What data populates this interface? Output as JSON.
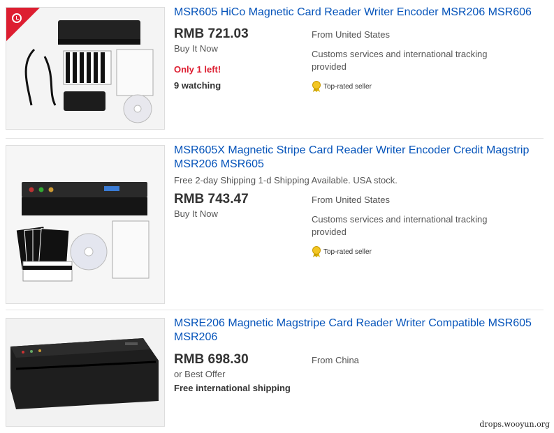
{
  "listings": [
    {
      "title": "MSR605 HiCo Magnetic Card Reader Writer Encoder MSR206 MSR606",
      "price": "RMB 721.03",
      "format": "Buy It Now",
      "stock": "Only 1 left!",
      "watching": "9 watching",
      "location": "From United States",
      "customs": "Customs services and international tracking provided",
      "badge": "Top-rated seller"
    },
    {
      "title": "MSR605X Magnetic Stripe Card Reader Writer Encoder Credit Magstrip MSR206 MSR605",
      "subtitle": "Free 2-day Shipping 1-d Shipping Available. USA stock.",
      "price": "RMB 743.47",
      "format": "Buy It Now",
      "location": "From United States",
      "customs": "Customs services and international tracking provided",
      "badge": "Top-rated seller"
    },
    {
      "title": "MSRE206 Magnetic Magstripe Card Reader Writer Compatible MSR605 MSR206",
      "price": "RMB 698.30",
      "format": "or Best Offer",
      "shipping": "Free international shipping",
      "location": "From China"
    }
  ],
  "watermark": "drops.wooyun.org",
  "colors": {
    "link": "#0654ba",
    "alert": "#dd1e31",
    "ribbon": "#dd1e31"
  },
  "icons": [
    "clock-icon",
    "top-rated-medal-icon"
  ]
}
